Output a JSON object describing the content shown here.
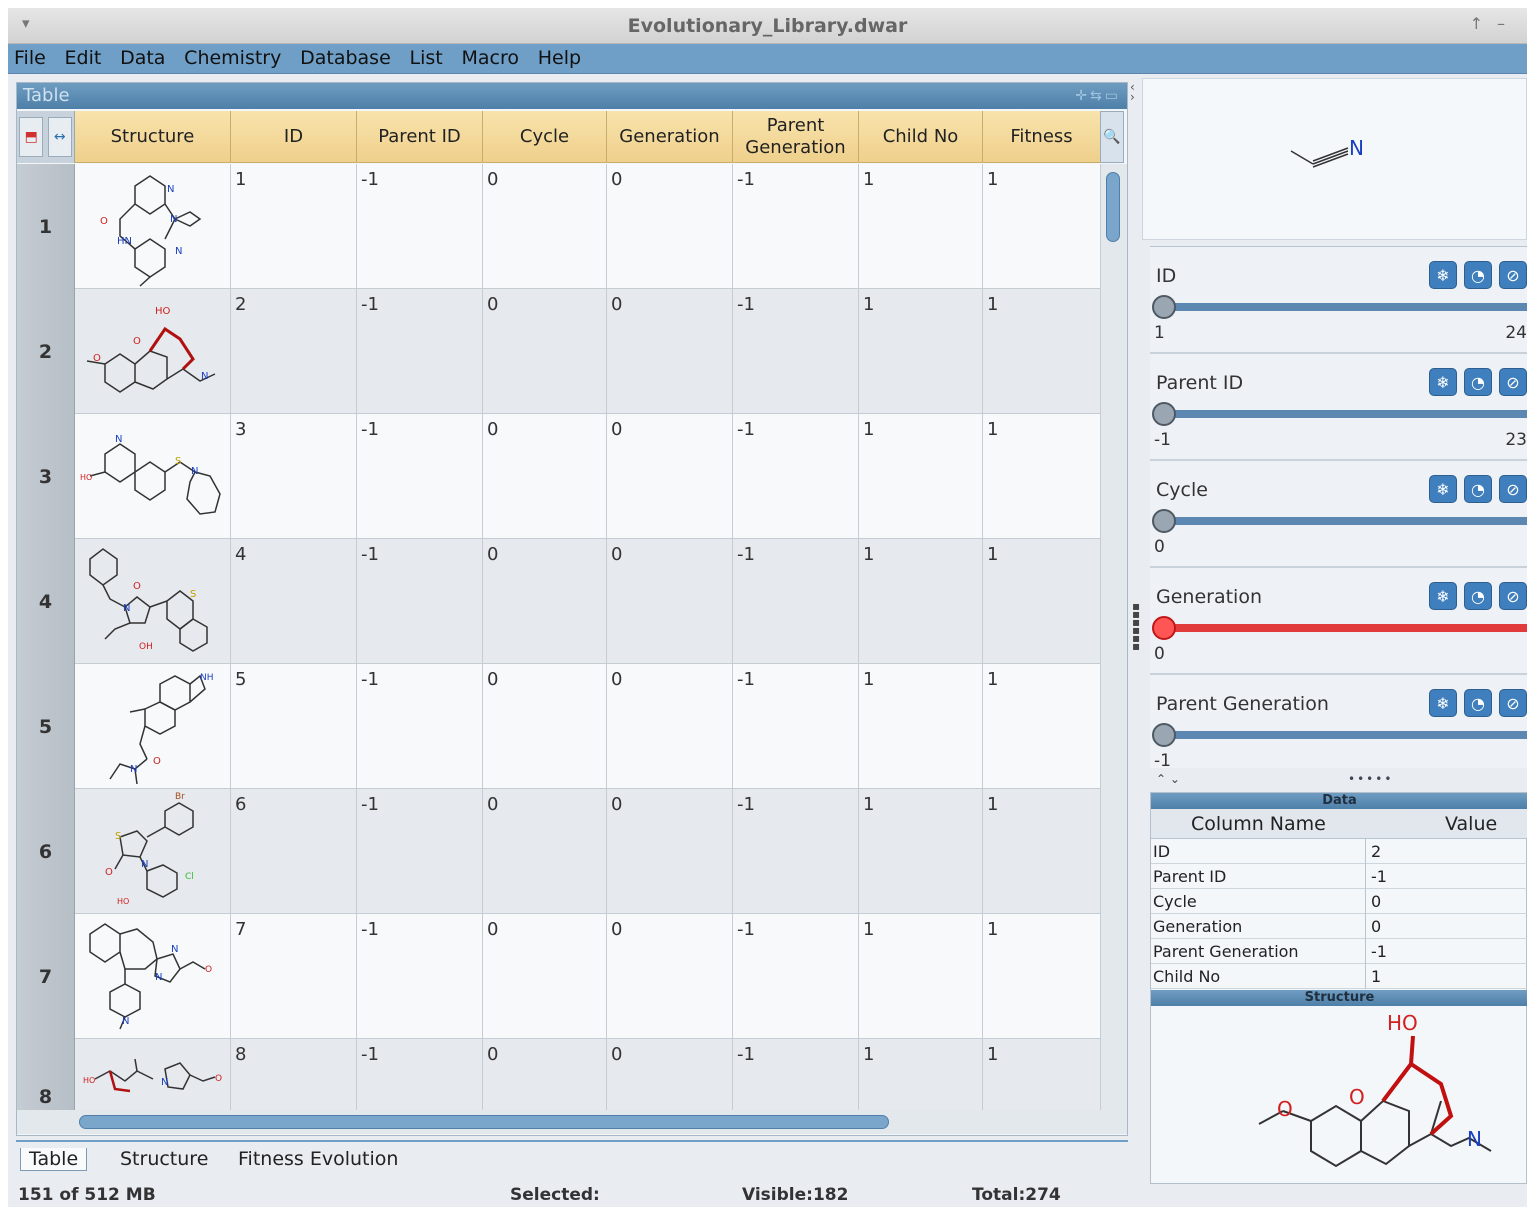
{
  "window": {
    "title": "Evolutionary_Library.dwar"
  },
  "menu": [
    "File",
    "Edit",
    "Data",
    "Chemistry",
    "Database",
    "List",
    "Macro",
    "Help"
  ],
  "table_panel": {
    "title": "Table",
    "columns": [
      "Structure",
      "ID",
      "Parent ID",
      "Cycle",
      "Generation",
      "Parent Generation",
      "Child No",
      "Fitness"
    ],
    "rows": [
      {
        "num": "1",
        "id": "1",
        "parent_id": "-1",
        "cycle": "0",
        "generation": "0",
        "parent_generation": "-1",
        "child_no": "1",
        "fitness": "1"
      },
      {
        "num": "2",
        "id": "2",
        "parent_id": "-1",
        "cycle": "0",
        "generation": "0",
        "parent_generation": "-1",
        "child_no": "1",
        "fitness": "1"
      },
      {
        "num": "3",
        "id": "3",
        "parent_id": "-1",
        "cycle": "0",
        "generation": "0",
        "parent_generation": "-1",
        "child_no": "1",
        "fitness": "1"
      },
      {
        "num": "4",
        "id": "4",
        "parent_id": "-1",
        "cycle": "0",
        "generation": "0",
        "parent_generation": "-1",
        "child_no": "1",
        "fitness": "1"
      },
      {
        "num": "5",
        "id": "5",
        "parent_id": "-1",
        "cycle": "0",
        "generation": "0",
        "parent_generation": "-1",
        "child_no": "1",
        "fitness": "1"
      },
      {
        "num": "6",
        "id": "6",
        "parent_id": "-1",
        "cycle": "0",
        "generation": "0",
        "parent_generation": "-1",
        "child_no": "1",
        "fitness": "1"
      },
      {
        "num": "7",
        "id": "7",
        "parent_id": "-1",
        "cycle": "0",
        "generation": "0",
        "parent_generation": "-1",
        "child_no": "1",
        "fitness": "1"
      },
      {
        "num": "8",
        "id": "8",
        "parent_id": "-1",
        "cycle": "0",
        "generation": "0",
        "parent_generation": "-1",
        "child_no": "1",
        "fitness": "1"
      }
    ]
  },
  "view_tabs": [
    "Table",
    "Structure",
    "Fitness Evolution"
  ],
  "status": {
    "memory": "151 of 512 MB",
    "selected": "Selected:",
    "visible": "Visible:182",
    "total": "Total:274"
  },
  "query_structure": {
    "atom": "N"
  },
  "filters": [
    {
      "label": "ID",
      "min": "1",
      "max": "24",
      "state": "normal"
    },
    {
      "label": "Parent ID",
      "min": "-1",
      "max": "23",
      "state": "normal"
    },
    {
      "label": "Cycle",
      "min": "0",
      "max": "",
      "state": "normal"
    },
    {
      "label": "Generation",
      "min": "0",
      "max": "",
      "state": "active"
    },
    {
      "label": "Parent Generation",
      "min": "-1",
      "max": "",
      "state": "normal"
    }
  ],
  "details": {
    "data_header": "Data",
    "col_name_header": "Column Name",
    "value_header": "Value",
    "rows": [
      {
        "name": "ID",
        "value": "2"
      },
      {
        "name": "Parent ID",
        "value": "-1"
      },
      {
        "name": "Cycle",
        "value": "0"
      },
      {
        "name": "Generation",
        "value": "0"
      },
      {
        "name": "Parent Generation",
        "value": "-1"
      },
      {
        "name": "Child No",
        "value": "1"
      }
    ],
    "structure_header": "Structure",
    "structure_labels": {
      "ho": "HO",
      "o1": "O",
      "o2": "O",
      "n": "N"
    }
  }
}
